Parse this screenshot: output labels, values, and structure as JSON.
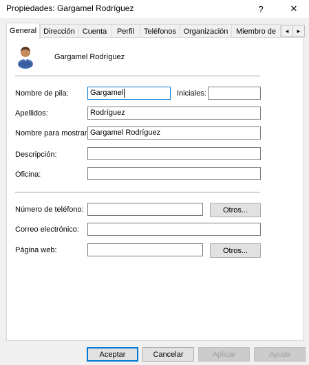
{
  "window": {
    "title": "Propiedades: Gargamel Rodríguez",
    "help_glyph": "?",
    "close_glyph": "✕"
  },
  "tabs": [
    {
      "label": "General"
    },
    {
      "label": "Dirección"
    },
    {
      "label": "Cuenta"
    },
    {
      "label": "Perfil"
    },
    {
      "label": "Teléfonos"
    },
    {
      "label": "Organización"
    },
    {
      "label": "Miembro de"
    }
  ],
  "tab_scroll": {
    "left": "◄",
    "right": "►"
  },
  "header": {
    "display_name": "Gargamel Rodríguez",
    "icon": "user-icon"
  },
  "form": {
    "first_name": {
      "label": "Nombre de pila:",
      "value": "Gargamel"
    },
    "initials": {
      "label": "Iniciales:",
      "value": ""
    },
    "last_name": {
      "label": "Apellidos:",
      "value": "Rodríguez"
    },
    "display_name": {
      "label": "Nombre para mostrar:",
      "value": "Gargamel Rodríguez"
    },
    "description": {
      "label": "Descripción:",
      "value": ""
    },
    "office": {
      "label": "Oficina:",
      "value": ""
    },
    "phone": {
      "label": "Número de teléfono:",
      "value": "",
      "other_button": "Otros..."
    },
    "email": {
      "label": "Correo electrónico:",
      "value": ""
    },
    "web_page": {
      "label": "Página web:",
      "value": "",
      "other_button": "Otros..."
    }
  },
  "footer": {
    "ok": "Aceptar",
    "cancel": "Cancelar",
    "apply": "Aplicar",
    "help": "Ayuda"
  }
}
